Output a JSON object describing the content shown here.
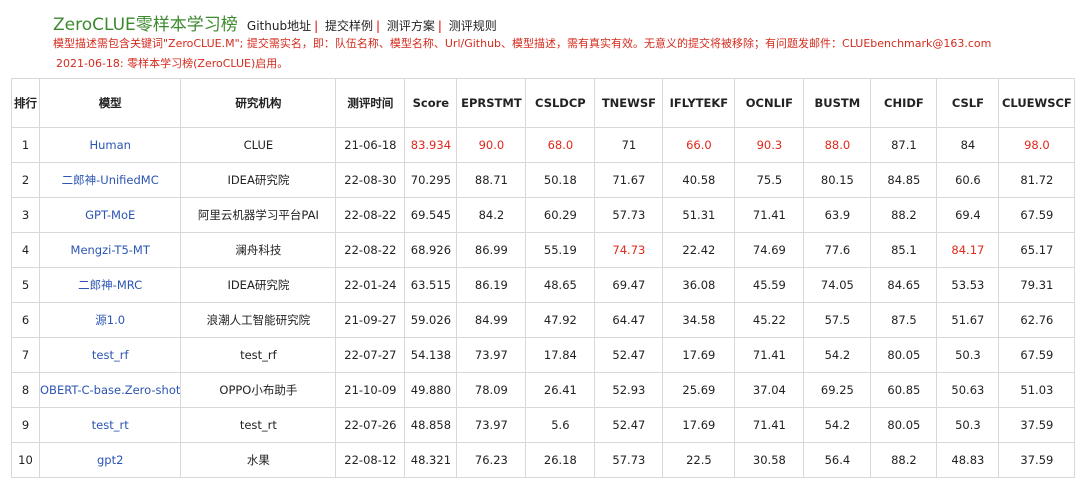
{
  "header": {
    "title": "ZeroCLUE零样本学习榜",
    "links": [
      "Github地址",
      "提交样例",
      "测评方案",
      "测评规则"
    ]
  },
  "notice": {
    "line1": "模型描述需包含关键词\"ZeroCLUE.M\"; 提交需实名，即：队伍名称、模型名称、Url/Github、模型描述，需有真实有效。无意义的提交将被移除；有问题发邮件：CLUEbenchmark@163.com",
    "line2": "2021-06-18: 零样本学习榜(ZeroCLUE)启用。"
  },
  "colors": {
    "title_green": "#3c8a2e",
    "notice_red": "#d42b1e",
    "link_blue": "#2b55b3",
    "highlight_red": "#e0281c"
  },
  "table": {
    "headers": [
      "排行",
      "模型",
      "研究机构",
      "测评时间",
      "Score",
      "EPRSTMT",
      "CSLDCP",
      "TNEWSF",
      "IFLYTEKF",
      "OCNLIF",
      "BUSTM",
      "CHIDF",
      "CSLF",
      "CLUEWSCF"
    ],
    "rows": [
      {
        "cells": [
          "1",
          "Human",
          "CLUE",
          "21-06-18",
          "83.934",
          "90.0",
          "68.0",
          "71",
          "66.0",
          "90.3",
          "88.0",
          "87.1",
          "84",
          "98.0"
        ],
        "highlight": [
          4,
          5,
          6,
          8,
          9,
          10,
          13
        ]
      },
      {
        "cells": [
          "2",
          "二郎神-UnifiedMC",
          "IDEA研究院",
          "22-08-30",
          "70.295",
          "88.71",
          "50.18",
          "71.67",
          "40.58",
          "75.5",
          "80.15",
          "84.85",
          "60.6",
          "81.72"
        ],
        "highlight": []
      },
      {
        "cells": [
          "3",
          "GPT-MoE",
          "阿里云机器学习平台PAI",
          "22-08-22",
          "69.545",
          "84.2",
          "60.29",
          "57.73",
          "51.31",
          "71.41",
          "63.9",
          "88.2",
          "69.4",
          "67.59"
        ],
        "highlight": []
      },
      {
        "cells": [
          "4",
          "Mengzi-T5-MT",
          "澜舟科技",
          "22-08-22",
          "68.926",
          "86.99",
          "55.19",
          "74.73",
          "22.42",
          "74.69",
          "77.6",
          "85.1",
          "84.17",
          "65.17"
        ],
        "highlight": [
          7,
          12
        ]
      },
      {
        "cells": [
          "5",
          "二郎神-MRC",
          "IDEA研究院",
          "22-01-24",
          "63.515",
          "86.19",
          "48.65",
          "69.47",
          "36.08",
          "45.59",
          "74.05",
          "84.65",
          "53.53",
          "79.31"
        ],
        "highlight": []
      },
      {
        "cells": [
          "6",
          "源1.0",
          "浪潮人工智能研究院",
          "21-09-27",
          "59.026",
          "84.99",
          "47.92",
          "64.47",
          "34.58",
          "45.22",
          "57.5",
          "87.5",
          "51.67",
          "62.76"
        ],
        "highlight": []
      },
      {
        "cells": [
          "7",
          "test_rf",
          "test_rf",
          "22-07-27",
          "54.138",
          "73.97",
          "17.84",
          "52.47",
          "17.69",
          "71.41",
          "54.2",
          "80.05",
          "50.3",
          "67.59"
        ],
        "highlight": []
      },
      {
        "cells": [
          "8",
          "OBERT-C-base.Zero-shot",
          "OPPO小布助手",
          "21-10-09",
          "49.880",
          "78.09",
          "26.41",
          "52.93",
          "25.69",
          "37.04",
          "69.25",
          "60.85",
          "50.63",
          "51.03"
        ],
        "highlight": []
      },
      {
        "cells": [
          "9",
          "test_rt",
          "test_rt",
          "22-07-26",
          "48.858",
          "73.97",
          "5.6",
          "52.47",
          "17.69",
          "71.41",
          "54.2",
          "80.05",
          "50.3",
          "37.59"
        ],
        "highlight": []
      },
      {
        "cells": [
          "10",
          "gpt2",
          "水果",
          "22-08-12",
          "48.321",
          "76.23",
          "26.18",
          "57.73",
          "22.5",
          "30.58",
          "56.4",
          "88.2",
          "48.83",
          "37.59"
        ],
        "highlight": []
      }
    ]
  }
}
